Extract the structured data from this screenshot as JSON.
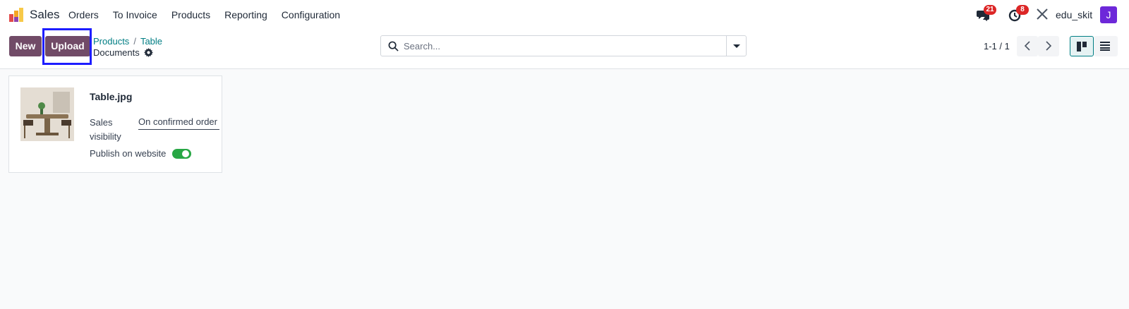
{
  "navbar": {
    "app_name": "Sales",
    "menu": [
      "Orders",
      "To Invoice",
      "Products",
      "Reporting",
      "Configuration"
    ],
    "messages_count": "21",
    "activities_count": "8",
    "user_name": "edu_skit",
    "avatar_letter": "J"
  },
  "control": {
    "new_label": "New",
    "upload_label": "Upload",
    "breadcrumb": [
      "Products",
      "Table"
    ],
    "sub_title": "Documents",
    "search_placeholder": "Search...",
    "pager": "1-1 / 1"
  },
  "card": {
    "title": "Table.jpg",
    "sales_visibility_label": "Sales visibility",
    "sales_visibility_value": "On confirmed order",
    "publish_label": "Publish on website",
    "publish_on": true
  },
  "colors": {
    "brand": "#714b67",
    "link": "#017e84",
    "badge": "#dc2626",
    "toggle_on": "#28a745",
    "highlight": "#1d1dff"
  }
}
